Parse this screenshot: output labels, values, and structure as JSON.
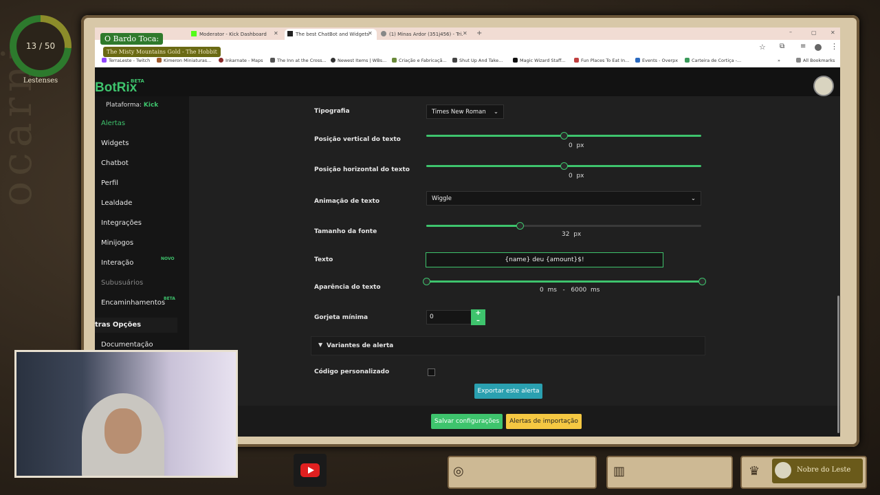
{
  "overlay": {
    "counter": "13 / 50",
    "counter_label": "Lestenses",
    "song_title": "O Bardo Toca:",
    "song_name": "The Misty Mountains Gold - The Hobbit",
    "bottom_label": "Nobre do Leste",
    "watermark": "ocarni"
  },
  "browser": {
    "tabs": [
      {
        "label": "Moderator - Kick Dashboard"
      },
      {
        "label": "The best ChatBot and Widgets"
      },
      {
        "label": "(1) Minas Ardor (351j456) - Tri..."
      }
    ],
    "bookmarks": [
      "TerraLeste - Twitch",
      "Kimeron Miniaturas...",
      "Inkarnate - Maps",
      "The Inn at the Cross...",
      "Newest Items | WBs...",
      "Criação e Fabricaçã...",
      "Shut Up And Take...",
      "Magic Wizard Staff...",
      "Fun Places To Eat In...",
      "Events - Overpx",
      "Carteira de Cortiça -..."
    ],
    "all_bookmarks": "All Bookmarks"
  },
  "app": {
    "logo": "BotRix",
    "beta": "BETA",
    "platform_label": "Plataforma:",
    "platform_value": "Kick",
    "sidebar": [
      {
        "label": "Alertas"
      },
      {
        "label": "Widgets"
      },
      {
        "label": "Chatbot"
      },
      {
        "label": "Perfil"
      },
      {
        "label": "Lealdade"
      },
      {
        "label": "Integrações"
      },
      {
        "label": "Minijogos"
      },
      {
        "label": "Interação",
        "badge": "NOVO"
      },
      {
        "label": "Subusuários"
      },
      {
        "label": "Encaminhamentos",
        "badge": "BETA"
      }
    ],
    "section_other": "tras Opções",
    "documentation": "Documentação"
  },
  "form": {
    "typography_label": "Tipografia",
    "typography_value": "Times New Roman",
    "vpos_label": "Posição vertical do texto",
    "vpos_value": "0",
    "vpos_unit": "px",
    "vpos_fraction": 0.5,
    "hpos_label": "Posição horizontal do texto",
    "hpos_value": "0",
    "hpos_unit": "px",
    "hpos_fraction": 0.5,
    "anim_label": "Animação de texto",
    "anim_value": "Wiggle",
    "font_size_label": "Tamanho da fonte",
    "font_size_value": "32",
    "font_size_unit": "px",
    "font_size_fraction": 0.34,
    "text_label": "Texto",
    "text_value": "{name} deu {amount}$!",
    "appearance_label": "Aparência do texto",
    "appearance_min": "0",
    "appearance_max": "6000",
    "appearance_unit": "ms",
    "appearance_sep": "-",
    "min_tip_label": "Gorjeta mínima",
    "min_tip_value": "0",
    "variants_label": "Variantes de alerta",
    "custom_code_label": "Código personalizado",
    "export_button": "Exportar este alerta",
    "save_button": "Salvar configurações",
    "import_button": "Alertas de importação"
  }
}
